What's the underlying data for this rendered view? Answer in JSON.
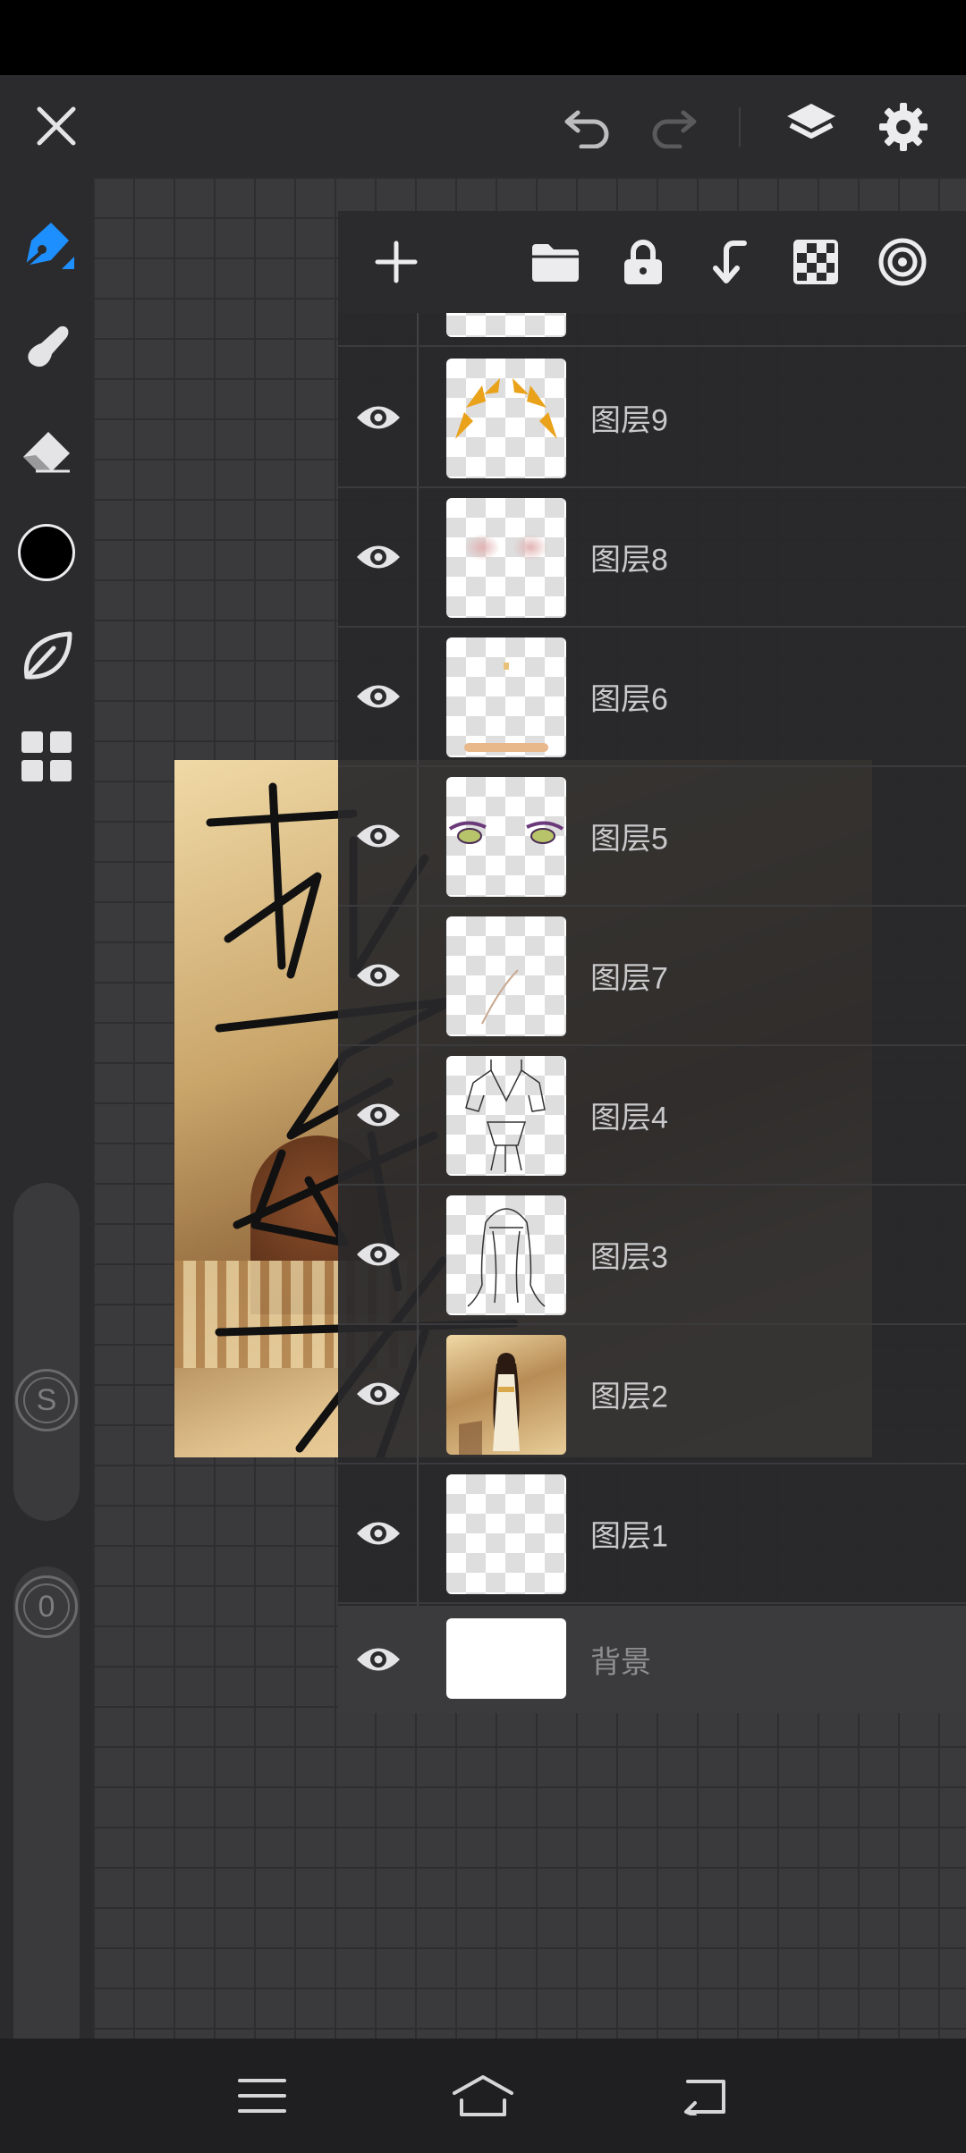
{
  "toolbar": {
    "close_icon": "close-icon",
    "undo_icon": "undo-icon",
    "redo_icon": "redo-icon",
    "layers_icon": "layers-icon",
    "settings_icon": "gear-icon"
  },
  "tools": [
    {
      "name": "brush-pen-icon",
      "active": true
    },
    {
      "name": "smudge-icon"
    },
    {
      "name": "eraser-icon"
    },
    {
      "name": "color-swatch",
      "color": "#000000"
    },
    {
      "name": "leaf-icon"
    },
    {
      "name": "grid-icon"
    }
  ],
  "sliders": {
    "size_label": "S",
    "opacity_label": "0"
  },
  "layers_toolbar": [
    "add-layer-icon",
    "folder-icon",
    "lock-icon",
    "merge-down-icon",
    "transparency-icon",
    "target-icon"
  ],
  "layers": [
    {
      "name": "图层9"
    },
    {
      "name": "图层8"
    },
    {
      "name": "图层6"
    },
    {
      "name": "图层5"
    },
    {
      "name": "图层7"
    },
    {
      "name": "图层4"
    },
    {
      "name": "图层3"
    },
    {
      "name": "图层2"
    },
    {
      "name": "图层1"
    },
    {
      "name": "背景"
    }
  ],
  "nav": [
    "menu-icon",
    "home-icon",
    "back-icon"
  ],
  "colors": {
    "accent": "#1e8fff",
    "panel": "#2b2b2d",
    "gold": "#e9a21a"
  }
}
